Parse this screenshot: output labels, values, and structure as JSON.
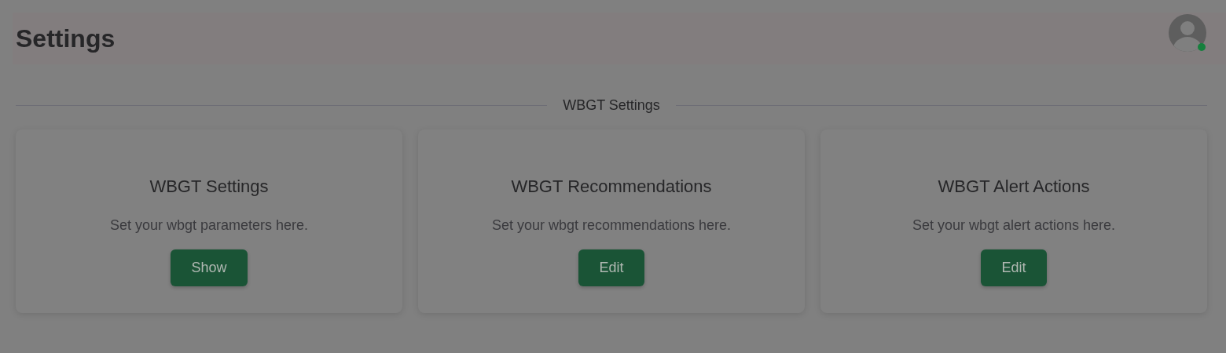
{
  "header": {
    "title": "Settings",
    "user": {
      "online": true
    }
  },
  "section": {
    "title": "WBGT Settings"
  },
  "cards": [
    {
      "title": "WBGT Settings",
      "description": "Set your wbgt parameters here.",
      "button": "Show"
    },
    {
      "title": "WBGT Recommendations",
      "description": "Set your wbgt recommendations here.",
      "button": "Edit"
    },
    {
      "title": "WBGT Alert Actions",
      "description": "Set your wbgt alert actions here.",
      "button": "Edit"
    }
  ]
}
